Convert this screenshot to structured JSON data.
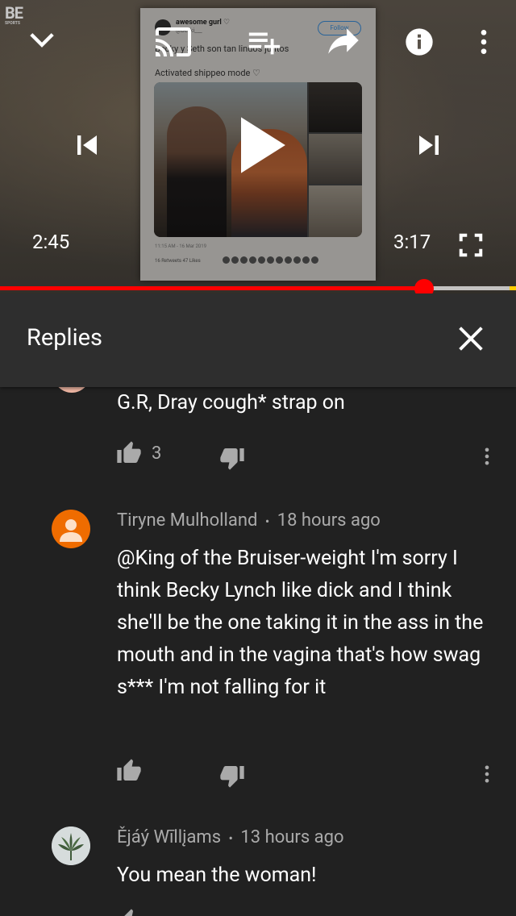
{
  "player": {
    "logo_text": "BE",
    "logo_subtext": "SPORTS",
    "tweet": {
      "author": "awesome gurl ♡",
      "handle": "@Bekki___",
      "follow_label": "Follow",
      "line1": "Becky y Seth son tan lindos juntos",
      "line2": "Activated shippeo mode ♡",
      "date": "11:15 AM - 16 Mar 2019",
      "stats": "16 Retweets  47 Likes"
    },
    "current_time": "2:45",
    "duration": "3:17",
    "progress_fraction": 0.8223,
    "icons": {
      "collapse": "chevron-down-icon",
      "cast": "cast-icon",
      "add_to_queue": "playlist-add-icon",
      "share": "share-icon",
      "info": "info-icon",
      "more": "more-vert-icon",
      "previous": "skip-previous-icon",
      "play": "play-icon",
      "next": "skip-next-icon",
      "fullscreen": "fullscreen-icon"
    },
    "colors": {
      "progress": "#ff0000",
      "progress_end": "#ffcc00"
    }
  },
  "replies": {
    "title": "Replies",
    "close_icon": "close-icon"
  },
  "comments": [
    {
      "text": "G.R, Dray cough* strap on",
      "likes": "3",
      "avatar_color": "#f0b7a4"
    },
    {
      "author": "Tiryne Mulholland",
      "time": "18 hours ago",
      "text": "@King of the Bruiser-weight I'm sorry I think Becky Lynch like dick and I think she'll be the one taking it in the ass in the mouth and in the vagina that's how swag s*** I'm not falling for it",
      "likes": "",
      "avatar_color": "#ef6c00"
    },
    {
      "author": "Ějáý Wīllįams",
      "time": "13 hours ago",
      "text": "You mean the woman!",
      "avatar_color": "#cfd8dc"
    }
  ],
  "separator": "•"
}
